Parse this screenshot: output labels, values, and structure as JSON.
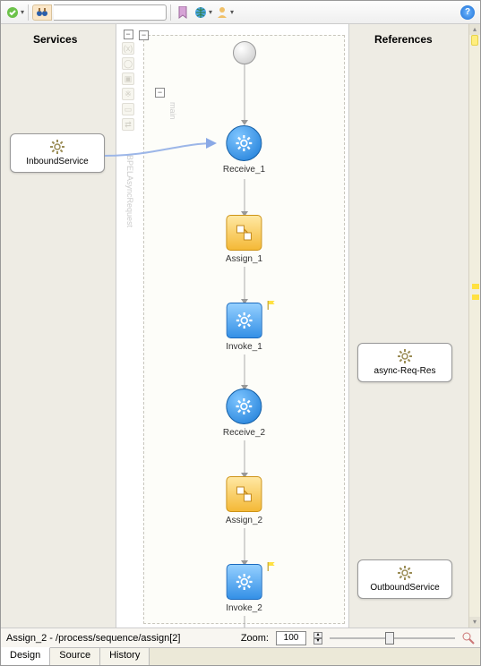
{
  "toolbar": {
    "search_placeholder": ""
  },
  "columns": {
    "services_label": "Services",
    "references_label": "References"
  },
  "services": {
    "inbound": "InboundService"
  },
  "references": {
    "async": "async-Req-Res",
    "outbound": "OutboundService"
  },
  "process": {
    "main_label": "main",
    "bpel_label": "BPELAsyncRequest",
    "nodes": {
      "receive1": "Receive_1",
      "assign1": "Assign_1",
      "invoke1": "Invoke_1",
      "receive2": "Receive_2",
      "assign2": "Assign_2",
      "invoke2": "Invoke_2"
    }
  },
  "statusbar": {
    "path": "Assign_2 - /process/sequence/assign[2]",
    "zoom_label": "Zoom:",
    "zoom_value": "100"
  },
  "tabs": {
    "design": "Design",
    "source": "Source",
    "history": "History"
  }
}
